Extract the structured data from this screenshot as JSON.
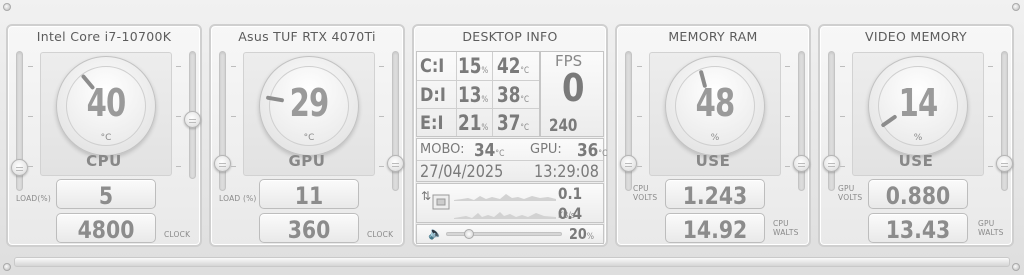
{
  "cpu_panel": {
    "title": "Intel Core i7-10700K",
    "gauge_value": "40",
    "gauge_unit": "°C",
    "gauge_label": "CPU",
    "label_load": "LOAD(%)",
    "label_clock": "CLOCK",
    "value_load": "5",
    "value_clock": "4800"
  },
  "gpu_panel": {
    "title": "Asus TUF RTX 4070Ti",
    "gauge_value": "29",
    "gauge_unit": "°C",
    "gauge_label": "GPU",
    "label_load": "LOAD (%)",
    "label_clock": "CLOCK",
    "value_load": "11",
    "value_clock": "360"
  },
  "desktop_info": {
    "title": "DESKTOP INFO",
    "drives": [
      {
        "label": "C:I",
        "percent": "15",
        "temp": "42"
      },
      {
        "label": "D:I",
        "percent": "13",
        "temp": "38"
      },
      {
        "label": "E:I",
        "percent": "21",
        "temp": "37"
      }
    ],
    "unit_percent": "%",
    "unit_celsius": "°C",
    "fps_label": "FPS",
    "fps_value": "0",
    "refresh_rate": "240 HZ",
    "mobo_label": "MOBO:",
    "mobo_temp": "34",
    "gpu_label": "GPU:",
    "gpu_temp": "36",
    "date": "27/04/2025",
    "time": "13:29:08",
    "net_upload": "0.1",
    "net_download": "0.4",
    "net_unit": "KB/s",
    "volume": "20",
    "volume_unit": "%",
    "volume_level": 0.2
  },
  "memory_panel": {
    "title": "MEMORY RAM",
    "gauge_value": "48",
    "gauge_unit": "%",
    "gauge_label": "USE",
    "label_volts": "CPU VOLTS",
    "label_watts": "CPU WALTS",
    "value_volts": "1.243",
    "value_watts": "14.92"
  },
  "video_panel": {
    "title": "VIDEO MEMORY",
    "gauge_value": "14",
    "gauge_unit": "%",
    "gauge_label": "USE",
    "label_volts": "GPU VOLTS",
    "label_watts": "GPU WALTS",
    "value_volts": "0.880",
    "value_watts": "13.43"
  }
}
